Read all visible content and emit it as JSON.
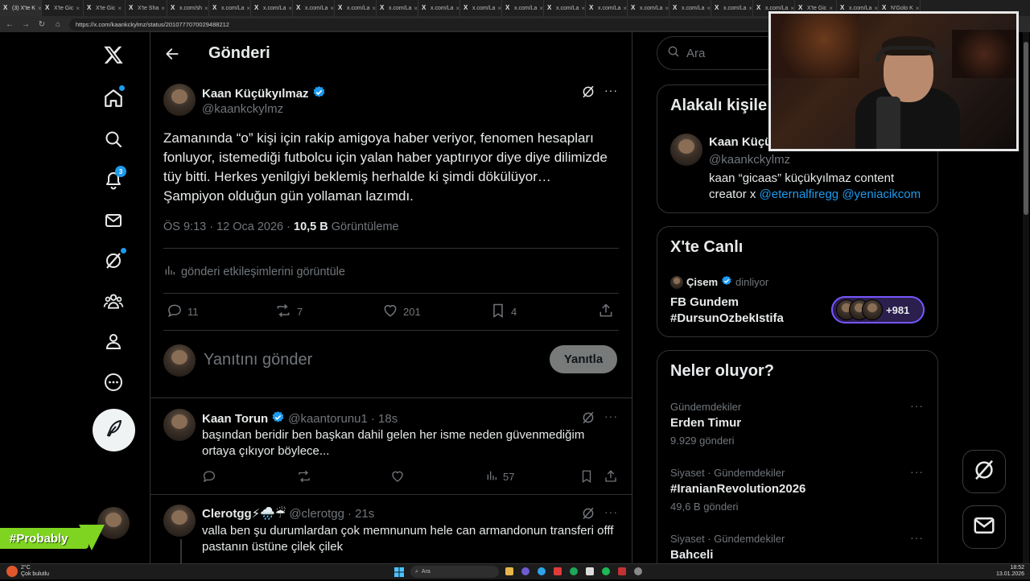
{
  "browser": {
    "tabs": [
      "(3) X'te K",
      "X'te Gic",
      "X'te Gic",
      "X'te Sha",
      "x.com/sh",
      "x.com/La",
      "x.com/La",
      "x.com/La",
      "x.com/La",
      "x.com/La",
      "x.com/La",
      "x.com/La",
      "x.com/La",
      "x.com/La",
      "x.com/La",
      "x.com/La",
      "x.com/La",
      "x.com/La",
      "x.com/La",
      "X'te Gic",
      "x.com/La",
      "N'Golo K"
    ],
    "url": "https://x.com/kaankckylmz/status/2010777070029488212"
  },
  "nav": {
    "notification_count": "3",
    "post_button_icon": "feather-icon"
  },
  "header": {
    "back_icon": "arrow-left-icon",
    "title": "Gönderi"
  },
  "post": {
    "author_name": "Kaan Küçükyılmaz",
    "author_handle": "@kaankckylmz",
    "text": "Zamanında “o” kişi için rakip amigoya haber veriyor, fenomen hesapları fonluyor, istemediği futbolcu için yalan haber yaptırıyor diye diye dilimizde tüy bitti. Herkes yenilgiyi beklemiş herhalde ki şimdi dökülüyor… Şampiyon olduğun gün yollaman lazımdı.",
    "time": "ÖS 9:13 · 12 Oca 2026 · ",
    "views_count": "10,5 B",
    "views_label": " Görüntüleme",
    "engagements_link": "gönderi etkileşimlerini görüntüle",
    "replies": "11",
    "reposts": "7",
    "likes": "201",
    "bookmarks": "4"
  },
  "reply_box": {
    "placeholder": "Yanıtını gönder",
    "button": "Yanıtla"
  },
  "replies": [
    {
      "name": "Kaan Torun",
      "handle": "@kaantorunu1",
      "time": "· 18s",
      "text": "başından beridir ben başkan dahil gelen her isme neden güvenmediğim ortaya çıkıyor böylece...",
      "views": "57"
    },
    {
      "name": "Clerotgg⚡🌧️☔",
      "handle": "@clerotgg",
      "time": "· 21s",
      "text": "valla ben şu durumlardan çok memnunum hele can armandonun transferi offf pastanın üstüne çilek çilek"
    }
  ],
  "search": {
    "placeholder": "Ara"
  },
  "related": {
    "title": "Alakalı kişile",
    "name": "Kaan Küçü",
    "handle": "@kaankckylmz",
    "bio": "kaan “gicaas” küçükyılmaz content creator x ",
    "mention1": "@eternalfiregg",
    "mention2": "@yeniacikcom"
  },
  "live": {
    "title": "X'te Canlı",
    "host": "Çisem",
    "status": "dinliyor",
    "space_title": "FB Gundem #DursunOzbekIstifa",
    "listeners": "+981"
  },
  "trends": {
    "title": "Neler oluyor?",
    "items": [
      {
        "meta": "Gündemdekiler",
        "name": "Erden Timur",
        "count": "9.929 gönderi"
      },
      {
        "meta": "Siyaset · Gündemdekiler",
        "name": "#IranianRevolution2026",
        "count": "49,6 B gönderi"
      },
      {
        "meta": "Siyaset · Gündemdekiler",
        "name": "Bahceli",
        "count": ""
      }
    ]
  },
  "overlay": {
    "tag": "#Probably"
  },
  "taskbar": {
    "weather_temp": "2°C",
    "weather_desc": "Çok bulutlu",
    "search": "Ara",
    "time": "18:52",
    "date": "13.01.2026"
  },
  "colors": {
    "accent": "#1d9bf0",
    "background": "#000000",
    "border": "#2f3336",
    "muted": "#71767b",
    "space_border": "#7856ff",
    "overlay_green": "#7fd321"
  }
}
